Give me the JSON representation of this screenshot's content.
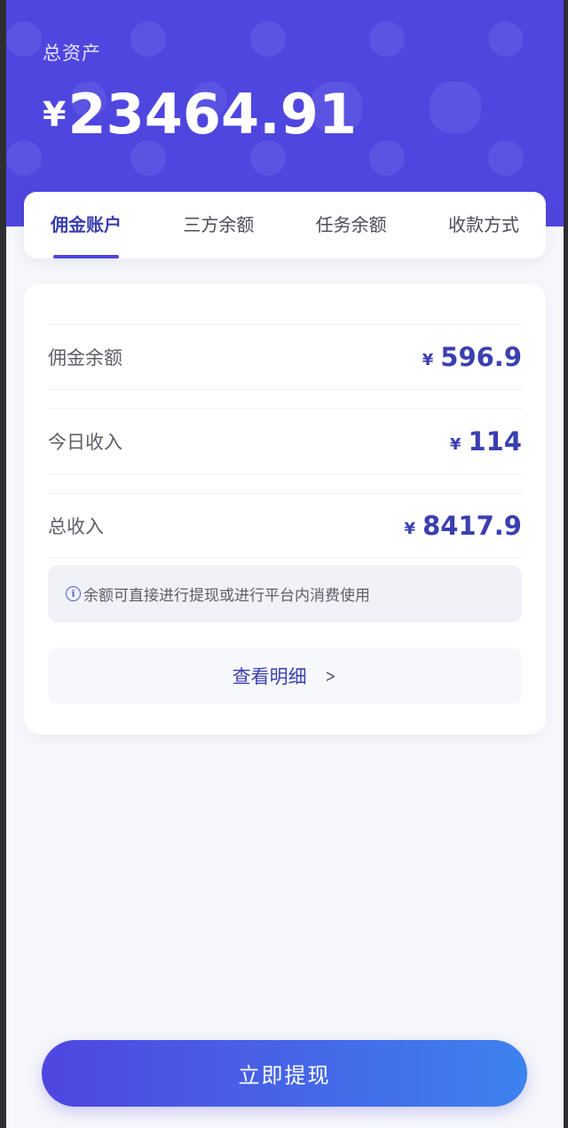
{
  "header": {
    "title": "总资产",
    "currency_symbol": "¥",
    "total_amount": "23464.91"
  },
  "tabs": [
    {
      "label": "佣金账户",
      "active": true
    },
    {
      "label": "三方余额",
      "active": false
    },
    {
      "label": "任务余额",
      "active": false
    },
    {
      "label": "收款方式",
      "active": false
    }
  ],
  "account": {
    "rows": [
      {
        "label": "佣金余额",
        "currency": "¥",
        "value": "596.9"
      },
      {
        "label": "今日收入",
        "currency": "¥",
        "value": "114"
      },
      {
        "label": "总收入",
        "currency": "¥",
        "value": "8417.9"
      }
    ],
    "tip_text": "余额可直接进行提现或进行平台内消费使用",
    "tip_icon": "info-icon",
    "detail_label": "查看明细",
    "detail_icon": "chevron-right-icon"
  },
  "withdraw_button": {
    "label": "立即提现"
  },
  "colors": {
    "brand": "#4f46e0",
    "brand_gradient_end": "#3d82ee",
    "accent_text": "#3b3fb0",
    "background": "#f6f7fb"
  }
}
